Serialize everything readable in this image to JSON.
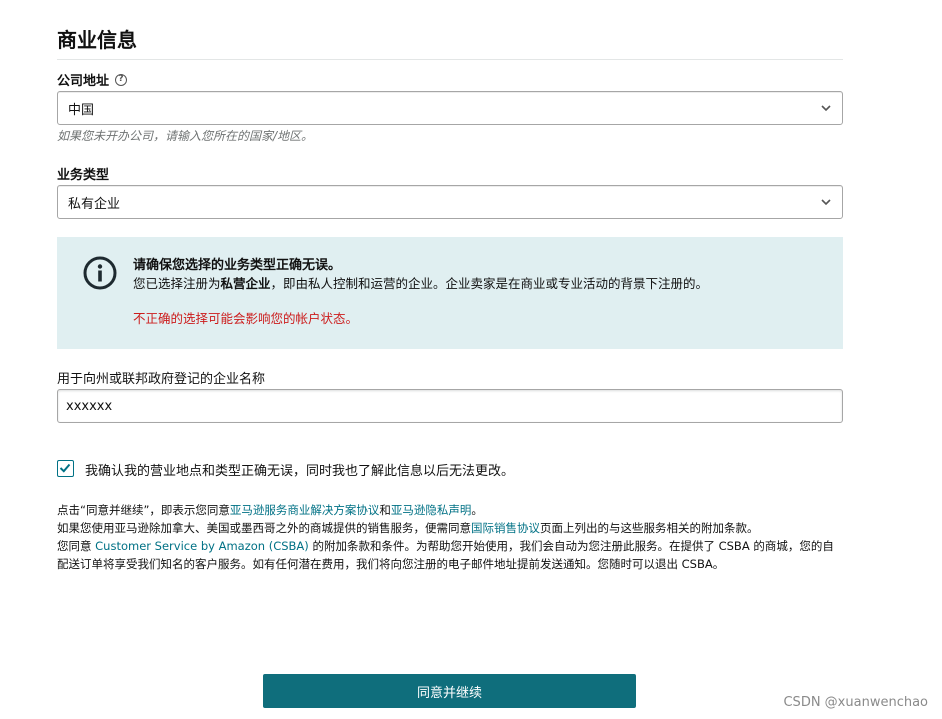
{
  "page": {
    "title": "商业信息"
  },
  "company_address": {
    "label": "公司地址",
    "selected": "中国",
    "hint": "如果您未开办公司，请输入您所在的国家/地区。"
  },
  "business_type": {
    "label": "业务类型",
    "selected": "私有企业"
  },
  "alert": {
    "title": "请确保您选择的业务类型正确无误。",
    "body_prefix": "您已选择注册为",
    "body_bold": "私营企业",
    "body_suffix": "，即由私人控制和运营的企业。企业卖家是在商业或专业活动的背景下注册的。",
    "warning": "不正确的选择可能会影响您的帐户状态。"
  },
  "business_name": {
    "label": "用于向州或联邦政府登记的企业名称",
    "value": "xxxxxx"
  },
  "confirm": {
    "checked": true,
    "label": "我确认我的营业地点和类型正确无误，同时我也了解此信息以后无法更改。"
  },
  "legal": {
    "line1_a": "点击“同意并继续”，即表示您同意",
    "line1_link1": "亚马逊服务商业解决方案协议",
    "line1_b": "和",
    "line1_link2": "亚马逊隐私声明",
    "line1_c": "。",
    "line2_a": "如果您使用亚马逊除加拿大、美国或墨西哥之外的商城提供的销售服务，便需同意",
    "line2_link": "国际销售协议",
    "line2_b": "页面上列出的与这些服务相关的附加条款。",
    "line3_a": "您同意 ",
    "line3_link": "Customer Service by Amazon (CSBA)",
    "line3_b": " 的附加条款和条件。为帮助您开始使用，我们会自动为您注册此服务。在提供了 CSBA 的商城，您的自",
    "line4": "配送订单将享受我们知名的客户服务。如有任何潜在费用，我们将向您注册的电子邮件地址提前发送通知。您随时可以退出 CSBA。"
  },
  "continue_button": {
    "label": "同意并继续"
  },
  "watermark": "CSDN @xuanwenchao",
  "colors": {
    "accent": "#007185",
    "button": "#0f6e7c",
    "alert_bg": "#e0eff1",
    "warning": "#cc1c1c"
  },
  "icons": [
    "help-icon",
    "chevron-down-icon",
    "info-icon",
    "checkmark-icon"
  ]
}
